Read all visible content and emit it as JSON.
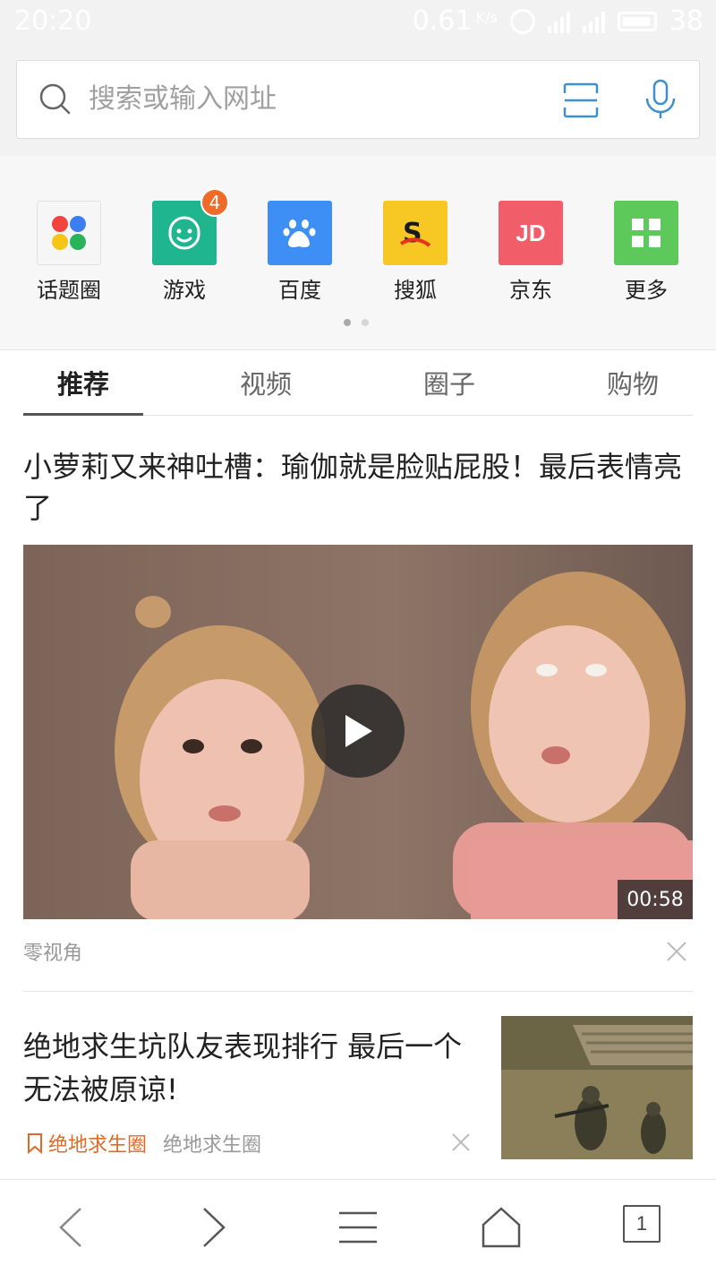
{
  "status_bar": {
    "time": "20:20",
    "speed": "0.61",
    "speed_unit": "K/s",
    "battery": "38"
  },
  "search": {
    "placeholder": "搜索或输入网址"
  },
  "quick_links": [
    {
      "label": "话题圈",
      "icon": "topic-circle-icon",
      "color": "#f4f4f4"
    },
    {
      "label": "游戏",
      "icon": "game-icon",
      "color": "#1fb58f",
      "badge": "4"
    },
    {
      "label": "百度",
      "icon": "baidu-paw-icon",
      "color": "#3d8ff5"
    },
    {
      "label": "搜狐",
      "icon": "sohu-icon",
      "color": "#f7c824"
    },
    {
      "label": "京东",
      "icon": "jd-icon",
      "color": "#f25d6a",
      "text": "JD"
    },
    {
      "label": "更多",
      "icon": "more-grid-icon",
      "color": "#5cc95a"
    }
  ],
  "tabs": [
    {
      "label": "推荐",
      "active": true
    },
    {
      "label": "视频",
      "active": false
    },
    {
      "label": "圈子",
      "active": false
    },
    {
      "label": "购物",
      "active": false
    }
  ],
  "articles": [
    {
      "title": "小萝莉又来神吐槽：瑜伽就是脸贴屁股！最后表情亮了",
      "duration": "00:58",
      "source": "零视角"
    },
    {
      "title": "绝地求生坑队友表现排行 最后一个无法被原谅!",
      "circle_tag": "绝地求生圈",
      "source": "绝地求生圈"
    }
  ],
  "bottom_nav": {
    "tab_count": "1"
  },
  "colors": {
    "accent_blue": "#3d8fcf",
    "tag_orange": "#e06b24",
    "badge_orange": "#f06a28"
  }
}
